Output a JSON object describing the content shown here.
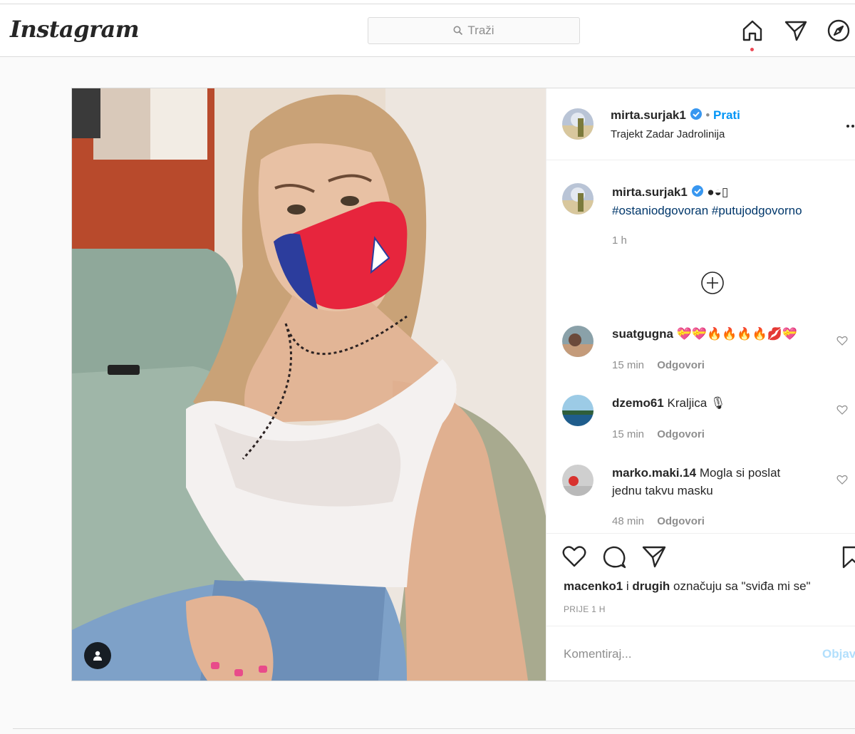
{
  "topbar": {
    "logo": "Instagram",
    "search_placeholder": "Traži"
  },
  "post": {
    "header": {
      "username": "mirta.surjak1",
      "follow": "Prati",
      "location": "Trajekt Zadar Jadrolinija"
    },
    "caption": {
      "username": "mirta.surjak1",
      "emoji": "●◒▯",
      "hashtags": "#ostaniodgovoran #putujodgovorno",
      "time": "1 h"
    },
    "comments": [
      {
        "username": "suatgugna",
        "text": "💝💝🔥🔥🔥🔥💋💝",
        "time": "15 min",
        "reply": "Odgovori"
      },
      {
        "username": "dzemo61",
        "text": "Kraljica 🎙",
        "time": "15 min",
        "reply": "Odgovori"
      },
      {
        "username": "marko.maki.14",
        "text": "Mogla si poslat",
        "text2": "jednu takvu masku",
        "time": "48 min",
        "reply": "Odgovori"
      }
    ],
    "likes": {
      "user": "macenko1",
      "connector": "i",
      "others": "drugih",
      "suffix": "označuju sa \"sviđa mi se\""
    },
    "posted_ago": "PRIJE 1 H",
    "comment_placeholder": "Komentiraj...",
    "post_button": "Objavi"
  },
  "colors": {
    "accent": "#0095f6",
    "notification": "#ed4956",
    "border": "#dbdbdb"
  },
  "icons": [
    "search-icon",
    "home-icon",
    "direct-icon",
    "explore-icon",
    "verified-icon",
    "more-icon",
    "load-more-icon",
    "heart-icon",
    "comment-icon",
    "share-icon",
    "save-icon",
    "user-tag-icon"
  ]
}
